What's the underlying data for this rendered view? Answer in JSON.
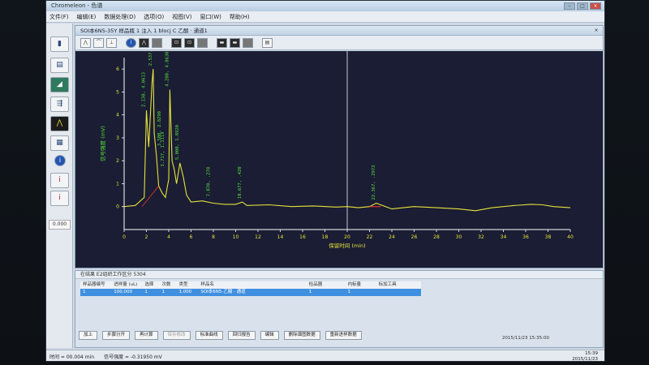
{
  "app": {
    "title": "Chromeleon - 色谱",
    "menu": [
      "文件(F)",
      "编辑(E)",
      "数据处理(D)",
      "选项(O)",
      "视图(V)",
      "窗口(W)",
      "帮助(H)"
    ]
  },
  "document": {
    "title": "SOI本6N5-35Y 样品瓶 1 注入 1 blocj C 乙酸 · 通道1"
  },
  "left_toolbar": {
    "value": "0.000"
  },
  "colors": {
    "plot_bg": "#1a1d33",
    "trace": "#e6e23c",
    "label": "#58e03c",
    "baseline": "#e03030",
    "axis": "#ffffff",
    "selection_row": "#3f8fe0"
  },
  "chart_data": {
    "type": "line",
    "title": "",
    "xlabel": "保留时间 (min)",
    "ylabel": "信号强度 (mV)",
    "xlim": [
      0,
      40
    ],
    "ylim": [
      -1,
      6.5
    ],
    "xticks": [
      0,
      2,
      4,
      6,
      8,
      10,
      12,
      14,
      16,
      18,
      20,
      22,
      24,
      26,
      28,
      30,
      32,
      34,
      36,
      38,
      40
    ],
    "yticks": [
      0,
      1,
      2,
      3,
      4,
      5,
      6
    ],
    "grid": false,
    "cursor_x": 20,
    "series": [
      {
        "x": [
          0,
          1.0,
          1.8,
          2.0,
          2.2,
          2.5,
          2.6,
          2.7,
          2.9,
          3.1,
          3.4,
          3.7,
          4.0,
          4.1,
          4.3,
          4.5,
          4.7,
          5.0,
          5.3,
          5.6,
          6.0,
          7.0,
          8.0,
          9.0,
          10.0,
          10.6,
          11.0,
          13.0,
          15.0,
          17.0,
          19.0,
          20.0,
          21.0,
          22.0,
          22.6,
          24.0,
          26.0,
          28.0,
          30.0,
          31.5,
          33.0,
          35.0,
          36.5,
          37.5,
          38.5,
          40.0
        ],
        "y": [
          0,
          0.05,
          0.4,
          4.2,
          2.6,
          5.4,
          6.0,
          3.2,
          2.2,
          0.9,
          0.6,
          0.4,
          1.2,
          5.1,
          2.0,
          1.6,
          1.0,
          1.9,
          1.3,
          0.5,
          0.2,
          0.25,
          0.15,
          0.1,
          0.1,
          0.2,
          0.05,
          0.08,
          0.0,
          0.03,
          -0.02,
          0.0,
          -0.05,
          0.0,
          0.15,
          -0.1,
          0.0,
          -0.05,
          -0.1,
          -0.18,
          -0.05,
          0.05,
          0.1,
          0.08,
          0.0,
          -0.05
        ]
      }
    ],
    "peak_labels": [
      {
        "x": 2.0,
        "y": 4.2,
        "text": "2.130, 4.0613"
      },
      {
        "x": 2.6,
        "y": 6.0,
        "text": "2.537, 5.2190"
      },
      {
        "x": 3.4,
        "y": 2.5,
        "text": "3.500, 2.8290"
      },
      {
        "x": 3.7,
        "y": 1.6,
        "text": "3.717, 1.1119"
      },
      {
        "x": 4.1,
        "y": 5.1,
        "text": "4.200, 4.8630"
      },
      {
        "x": 5.0,
        "y": 1.9,
        "text": "5.000, 1.8920"
      },
      {
        "x": 7.8,
        "y": 0.3,
        "text": "7.870, .278"
      },
      {
        "x": 10.6,
        "y": 0.2,
        "text": "10.677, .420"
      },
      {
        "x": 22.6,
        "y": 0.15,
        "text": "22.367, .2972"
      }
    ]
  },
  "results_panel": {
    "title": "在结果 E2组织工作区分 5304",
    "headers": [
      "样品器编号",
      "进样量 (uL)",
      "选择",
      "次数",
      "类型",
      "样品名",
      "检品器",
      "内标量",
      "标加工具"
    ],
    "row": [
      "1",
      "100.000",
      "1",
      "1",
      "1.000",
      "SOI本6N5-乙酸 · 通道",
      "1",
      "1",
      ""
    ],
    "buttons": [
      "加上",
      "步骤分开",
      "再计算",
      "保存修改",
      "标准曲线",
      "回归报告",
      "编辑",
      "删除谱图数据",
      "重新进样数据"
    ]
  },
  "status": {
    "time_readout": "时间 = 00.004 min",
    "signal_readout": "信号强度 = -0.31950 mV",
    "datetime": "2015/11/23  15:35:00",
    "clock": "15:39",
    "clock_date": "2015/11/23"
  }
}
